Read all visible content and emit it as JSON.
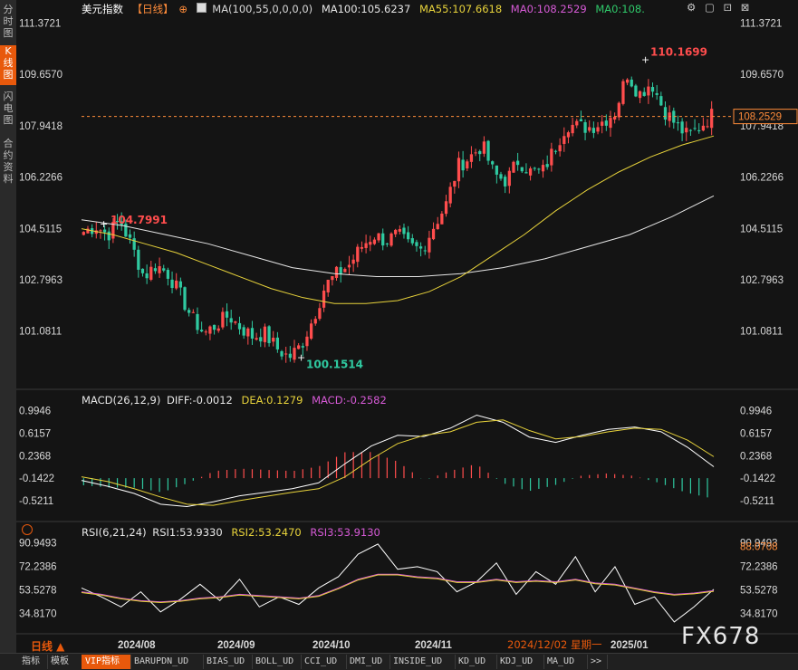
{
  "left_rail": [
    {
      "label": "分时图",
      "active": false
    },
    {
      "label": "K线图",
      "active": true
    },
    {
      "label": "闪电图",
      "active": false
    },
    {
      "label": "合约资料",
      "active": false
    }
  ],
  "header": {
    "symbol": "美元指数",
    "period": "【日线】",
    "ma_params": "MA(100,55,0,0,0,0)",
    "ma100": "MA100:105.6237",
    "ma55": "MA55:107.6618",
    "ma0a": "MA0:108.2529",
    "ma0b": "MA0:108."
  },
  "colors": {
    "up": "#ff4d4d",
    "down": "#2fc9a0",
    "ma55": "#e8d33b",
    "ma100": "#e6e6e6",
    "dea": "#e8d33b",
    "macd": "#d65ad6",
    "rsi2": "#e8d33b",
    "rsi3": "#d65ad6",
    "price_tag": "#ff8c3a"
  },
  "main_y_labels": [
    "111.3721",
    "109.6570",
    "107.9418",
    "106.2266",
    "104.5115",
    "102.7963",
    "101.0811"
  ],
  "last_price_tag": "108.2529",
  "high_annotation": "110.1699",
  "low_annotation": "100.1514",
  "left_high_annotation": "104.7991",
  "macd_header": {
    "title": "MACD(26,12,9)",
    "diff": "DIFF:-0.0012",
    "dea": "DEA:0.1279",
    "macd": "MACD:-0.2582"
  },
  "macd_y_labels": [
    "0.9946",
    "0.6157",
    "0.2368",
    "-0.1422",
    "-0.5211"
  ],
  "rsi_header": {
    "title": "RSI(6,21,24)",
    "rsi1": "RSI1:53.9330",
    "rsi2": "RSI2:53.2470",
    "rsi3": "RSI3:53.9130"
  },
  "rsi_y_labels": [
    "90.9493",
    "72.2386",
    "53.5278",
    "34.8170"
  ],
  "rsi_right_labels": [
    "90.9493",
    "88.0708",
    "72.2386",
    "53.5278",
    "34.8170"
  ],
  "x_labels": [
    "2024/08",
    "2024/09",
    "2024/10",
    "2024/11",
    "2025/01"
  ],
  "cursor_date": "2024/12/02 星期一",
  "period_label": "日线 ▲",
  "watermark": "FX678",
  "bottom_tabs": [
    "指标",
    "模板",
    "VIP指标",
    "BARUPDN_UD",
    "BIAS_UD",
    "BOLL_UD",
    "CCI_UD",
    "DMI_UD",
    "INSIDE_UD",
    "KD_UD",
    "KDJ_UD",
    "MA_UD",
    ">>"
  ],
  "chart_data": [
    {
      "type": "candlestick",
      "title": "美元指数 【日线】",
      "ylim": [
        99.8,
        111.6
      ],
      "series": [
        {
          "name": "MA55",
          "value_last": 107.6618
        },
        {
          "name": "MA100",
          "value_last": 105.6237
        }
      ],
      "ohlc_waypoints": [
        104.4,
        104.6,
        104.3,
        104.8,
        103.9,
        102.9,
        103.3,
        103.0,
        102.3,
        101.5,
        101.0,
        101.3,
        101.6,
        101.2,
        100.9,
        101.0,
        100.5,
        100.2,
        100.6,
        101.5,
        102.6,
        103.0,
        103.3,
        103.9,
        104.3,
        104.1,
        104.3,
        103.9,
        103.8,
        104.6,
        105.3,
        106.6,
        106.9,
        107.3,
        106.3,
        106.1,
        106.8,
        106.4,
        106.4,
        107.2,
        108.0,
        107.9,
        107.9,
        108.1,
        108.4,
        109.7,
        109.0,
        109.4,
        108.5,
        108.0,
        107.6,
        107.9,
        108.3
      ],
      "ma55_points": [
        104.5,
        104.3,
        104.0,
        103.7,
        103.3,
        102.9,
        102.5,
        102.2,
        102.0,
        102.0,
        102.1,
        102.4,
        102.9,
        103.6,
        104.3,
        105.1,
        105.8,
        106.4,
        106.9,
        107.3,
        107.6
      ],
      "ma100_points": [
        104.8,
        104.6,
        104.3,
        104.0,
        103.6,
        103.2,
        103.0,
        102.9,
        102.9,
        103.0,
        103.2,
        103.5,
        103.9,
        104.3,
        104.9,
        105.6
      ]
    },
    {
      "type": "line",
      "title": "MACD(26,12,9)",
      "ylim": [
        -0.72,
        1.08
      ],
      "series": [
        {
          "name": "DIFF",
          "value_last": -0.0012
        },
        {
          "name": "DEA",
          "value_last": 0.1279
        },
        {
          "name": "MACD",
          "value_last": -0.2582
        }
      ],
      "diff_points": [
        -0.18,
        -0.28,
        -0.4,
        -0.58,
        -0.62,
        -0.54,
        -0.44,
        -0.38,
        -0.32,
        -0.22,
        0.1,
        0.4,
        0.58,
        0.56,
        0.7,
        0.92,
        0.8,
        0.55,
        0.46,
        0.58,
        0.68,
        0.72,
        0.64,
        0.38,
        0.05
      ],
      "dea_points": [
        -0.12,
        -0.2,
        -0.32,
        -0.46,
        -0.58,
        -0.6,
        -0.52,
        -0.45,
        -0.38,
        -0.32,
        -0.12,
        0.18,
        0.44,
        0.58,
        0.64,
        0.8,
        0.84,
        0.66,
        0.52,
        0.56,
        0.64,
        0.7,
        0.68,
        0.5,
        0.22
      ]
    },
    {
      "type": "line",
      "title": "RSI(6,21,24)",
      "ylim": [
        20,
        95
      ],
      "series": [
        {
          "name": "RSI1",
          "value_last": 53.933
        },
        {
          "name": "RSI2",
          "value_last": 53.247
        },
        {
          "name": "RSI3",
          "value_last": 53.913
        }
      ],
      "rsi1_points": [
        55,
        48,
        40,
        52,
        36,
        46,
        58,
        45,
        62,
        40,
        48,
        42,
        55,
        64,
        82,
        90,
        70,
        72,
        68,
        52,
        60,
        75,
        50,
        68,
        58,
        80,
        52,
        72,
        42,
        48,
        28,
        40,
        54
      ],
      "rsi2_points": [
        52,
        50,
        47,
        45,
        44,
        45,
        47,
        48,
        50,
        49,
        48,
        47,
        49,
        55,
        62,
        66,
        66,
        64,
        63,
        60,
        60,
        62,
        60,
        61,
        60,
        62,
        59,
        58,
        55,
        52,
        50,
        51,
        53
      ]
    }
  ]
}
